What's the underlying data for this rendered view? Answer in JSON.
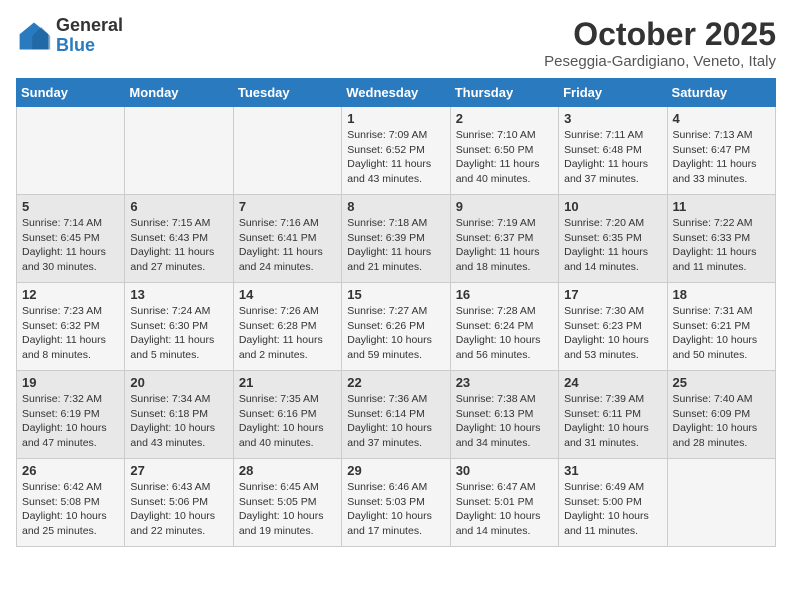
{
  "logo": {
    "general": "General",
    "blue": "Blue"
  },
  "title": "October 2025",
  "subtitle": "Peseggia-Gardigiano, Veneto, Italy",
  "weekdays": [
    "Sunday",
    "Monday",
    "Tuesday",
    "Wednesday",
    "Thursday",
    "Friday",
    "Saturday"
  ],
  "weeks": [
    [
      {
        "day": "",
        "info": ""
      },
      {
        "day": "",
        "info": ""
      },
      {
        "day": "",
        "info": ""
      },
      {
        "day": "1",
        "info": "Sunrise: 7:09 AM\nSunset: 6:52 PM\nDaylight: 11 hours and 43 minutes."
      },
      {
        "day": "2",
        "info": "Sunrise: 7:10 AM\nSunset: 6:50 PM\nDaylight: 11 hours and 40 minutes."
      },
      {
        "day": "3",
        "info": "Sunrise: 7:11 AM\nSunset: 6:48 PM\nDaylight: 11 hours and 37 minutes."
      },
      {
        "day": "4",
        "info": "Sunrise: 7:13 AM\nSunset: 6:47 PM\nDaylight: 11 hours and 33 minutes."
      }
    ],
    [
      {
        "day": "5",
        "info": "Sunrise: 7:14 AM\nSunset: 6:45 PM\nDaylight: 11 hours and 30 minutes."
      },
      {
        "day": "6",
        "info": "Sunrise: 7:15 AM\nSunset: 6:43 PM\nDaylight: 11 hours and 27 minutes."
      },
      {
        "day": "7",
        "info": "Sunrise: 7:16 AM\nSunset: 6:41 PM\nDaylight: 11 hours and 24 minutes."
      },
      {
        "day": "8",
        "info": "Sunrise: 7:18 AM\nSunset: 6:39 PM\nDaylight: 11 hours and 21 minutes."
      },
      {
        "day": "9",
        "info": "Sunrise: 7:19 AM\nSunset: 6:37 PM\nDaylight: 11 hours and 18 minutes."
      },
      {
        "day": "10",
        "info": "Sunrise: 7:20 AM\nSunset: 6:35 PM\nDaylight: 11 hours and 14 minutes."
      },
      {
        "day": "11",
        "info": "Sunrise: 7:22 AM\nSunset: 6:33 PM\nDaylight: 11 hours and 11 minutes."
      }
    ],
    [
      {
        "day": "12",
        "info": "Sunrise: 7:23 AM\nSunset: 6:32 PM\nDaylight: 11 hours and 8 minutes."
      },
      {
        "day": "13",
        "info": "Sunrise: 7:24 AM\nSunset: 6:30 PM\nDaylight: 11 hours and 5 minutes."
      },
      {
        "day": "14",
        "info": "Sunrise: 7:26 AM\nSunset: 6:28 PM\nDaylight: 11 hours and 2 minutes."
      },
      {
        "day": "15",
        "info": "Sunrise: 7:27 AM\nSunset: 6:26 PM\nDaylight: 10 hours and 59 minutes."
      },
      {
        "day": "16",
        "info": "Sunrise: 7:28 AM\nSunset: 6:24 PM\nDaylight: 10 hours and 56 minutes."
      },
      {
        "day": "17",
        "info": "Sunrise: 7:30 AM\nSunset: 6:23 PM\nDaylight: 10 hours and 53 minutes."
      },
      {
        "day": "18",
        "info": "Sunrise: 7:31 AM\nSunset: 6:21 PM\nDaylight: 10 hours and 50 minutes."
      }
    ],
    [
      {
        "day": "19",
        "info": "Sunrise: 7:32 AM\nSunset: 6:19 PM\nDaylight: 10 hours and 47 minutes."
      },
      {
        "day": "20",
        "info": "Sunrise: 7:34 AM\nSunset: 6:18 PM\nDaylight: 10 hours and 43 minutes."
      },
      {
        "day": "21",
        "info": "Sunrise: 7:35 AM\nSunset: 6:16 PM\nDaylight: 10 hours and 40 minutes."
      },
      {
        "day": "22",
        "info": "Sunrise: 7:36 AM\nSunset: 6:14 PM\nDaylight: 10 hours and 37 minutes."
      },
      {
        "day": "23",
        "info": "Sunrise: 7:38 AM\nSunset: 6:13 PM\nDaylight: 10 hours and 34 minutes."
      },
      {
        "day": "24",
        "info": "Sunrise: 7:39 AM\nSunset: 6:11 PM\nDaylight: 10 hours and 31 minutes."
      },
      {
        "day": "25",
        "info": "Sunrise: 7:40 AM\nSunset: 6:09 PM\nDaylight: 10 hours and 28 minutes."
      }
    ],
    [
      {
        "day": "26",
        "info": "Sunrise: 6:42 AM\nSunset: 5:08 PM\nDaylight: 10 hours and 25 minutes."
      },
      {
        "day": "27",
        "info": "Sunrise: 6:43 AM\nSunset: 5:06 PM\nDaylight: 10 hours and 22 minutes."
      },
      {
        "day": "28",
        "info": "Sunrise: 6:45 AM\nSunset: 5:05 PM\nDaylight: 10 hours and 19 minutes."
      },
      {
        "day": "29",
        "info": "Sunrise: 6:46 AM\nSunset: 5:03 PM\nDaylight: 10 hours and 17 minutes."
      },
      {
        "day": "30",
        "info": "Sunrise: 6:47 AM\nSunset: 5:01 PM\nDaylight: 10 hours and 14 minutes."
      },
      {
        "day": "31",
        "info": "Sunrise: 6:49 AM\nSunset: 5:00 PM\nDaylight: 10 hours and 11 minutes."
      },
      {
        "day": "",
        "info": ""
      }
    ]
  ]
}
